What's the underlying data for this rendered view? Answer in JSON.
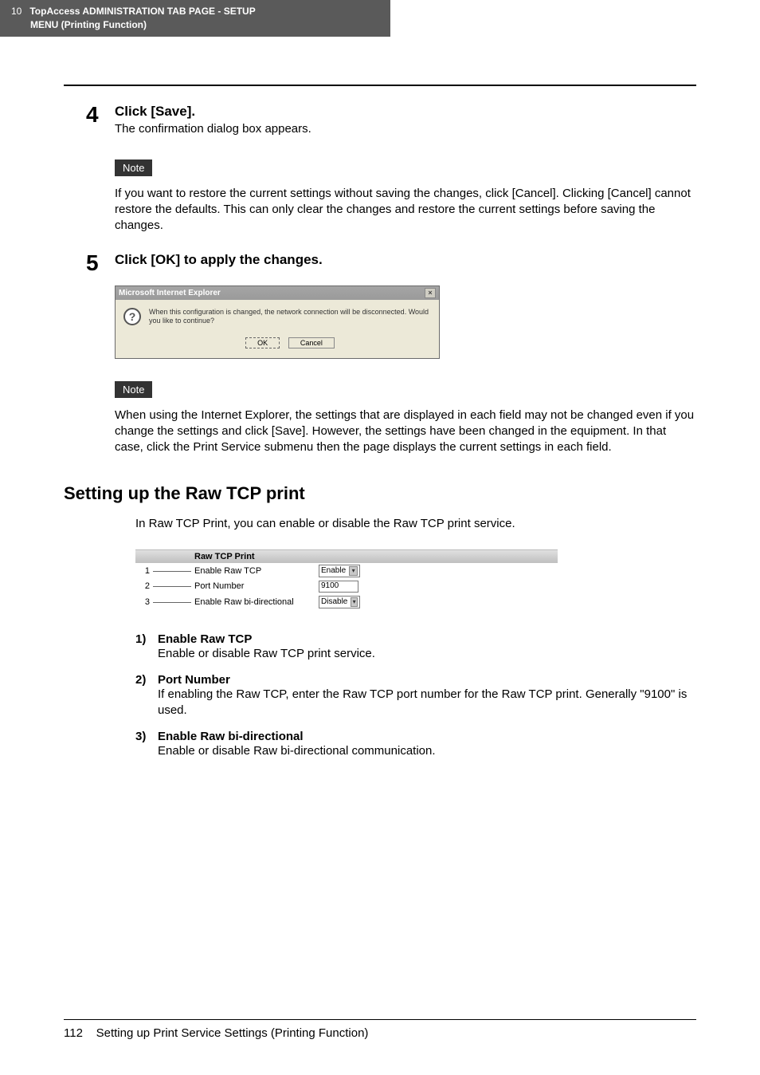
{
  "header": {
    "chapter_num": "10",
    "line1": "TopAccess ADMINISTRATION TAB PAGE - SETUP",
    "line2": "MENU (Printing Function)"
  },
  "step4": {
    "num": "4",
    "title": "Click [Save].",
    "text": "The confirmation dialog box appears."
  },
  "note1": {
    "label": "Note",
    "text": "If you want to restore the current settings without saving the changes, click [Cancel]. Clicking [Cancel] cannot restore the defaults.  This can only clear the changes and restore the current settings before saving the changes."
  },
  "step5": {
    "num": "5",
    "title": "Click [OK] to apply the changes."
  },
  "dialog": {
    "title": "Microsoft Internet Explorer",
    "close": "×",
    "icon": "?",
    "message": "When this configuration is changed, the network connection will be disconnected.  Would you like to continue?",
    "ok": "OK",
    "cancel": "Cancel"
  },
  "note2": {
    "label": "Note",
    "text": "When using the Internet Explorer, the settings that are displayed in each field may not be changed even if you change the settings and click [Save].  However, the settings have been changed in the equipment.  In that case, click the Print Service submenu then the page displays the current settings in each field."
  },
  "section": {
    "title": "Setting up the Raw TCP print",
    "intro": "In Raw TCP Print, you can enable or disable the Raw TCP print service."
  },
  "rawtcp": {
    "heading": "Raw TCP Print",
    "rows": [
      {
        "num": "1",
        "label": "Enable Raw TCP",
        "value": "Enable",
        "type": "dropdown"
      },
      {
        "num": "2",
        "label": "Port Number",
        "value": "9100",
        "type": "input"
      },
      {
        "num": "3",
        "label": "Enable Raw bi-directional",
        "value": "Disable",
        "type": "dropdown"
      }
    ]
  },
  "defs": [
    {
      "num": "1)",
      "title": "Enable Raw TCP",
      "text": "Enable or disable Raw TCP print service."
    },
    {
      "num": "2)",
      "title": "Port Number",
      "text": "If enabling the Raw TCP, enter the Raw TCP port number for the Raw TCP print.  Generally \"9100\" is used."
    },
    {
      "num": "3)",
      "title": "Enable Raw bi-directional",
      "text": "Enable or disable Raw bi-directional communication."
    }
  ],
  "footer": {
    "page": "112",
    "title": "Setting up Print Service Settings (Printing Function)"
  }
}
